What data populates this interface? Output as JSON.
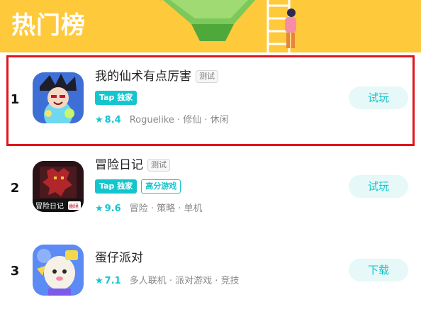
{
  "banner": {
    "title": "热门榜"
  },
  "apps": [
    {
      "rank": "1",
      "name": "我的仙术有点厉害",
      "badge": "测试",
      "tags": [
        {
          "label": "Tap 独家",
          "style": "filled"
        }
      ],
      "score": "8.4",
      "genres": "Roguelike · 修仙 · 休闲",
      "action": "试玩",
      "icon": "xianshu-app-icon"
    },
    {
      "rank": "2",
      "name": "冒险日记",
      "badge": "测试",
      "tags": [
        {
          "label": "Tap 独家",
          "style": "filled"
        },
        {
          "label": "高分游戏",
          "style": "outline"
        }
      ],
      "score": "9.6",
      "genres": "冒险 · 策略 · 单机",
      "action": "试玩",
      "icon": "adventure-diary-app-icon",
      "icon_text": {
        "title": "冒险日记",
        "brand": "幽境"
      }
    },
    {
      "rank": "3",
      "name": "蛋仔派对",
      "badge": "",
      "tags": [],
      "score": "7.1",
      "genres": "多人联机 · 派对游戏 · 竞技",
      "action": "下载",
      "icon": "eggy-party-app-icon"
    }
  ],
  "colors": {
    "accent": "#15C5CE",
    "banner": "#FFC93C",
    "highlight": "#E0151B"
  }
}
